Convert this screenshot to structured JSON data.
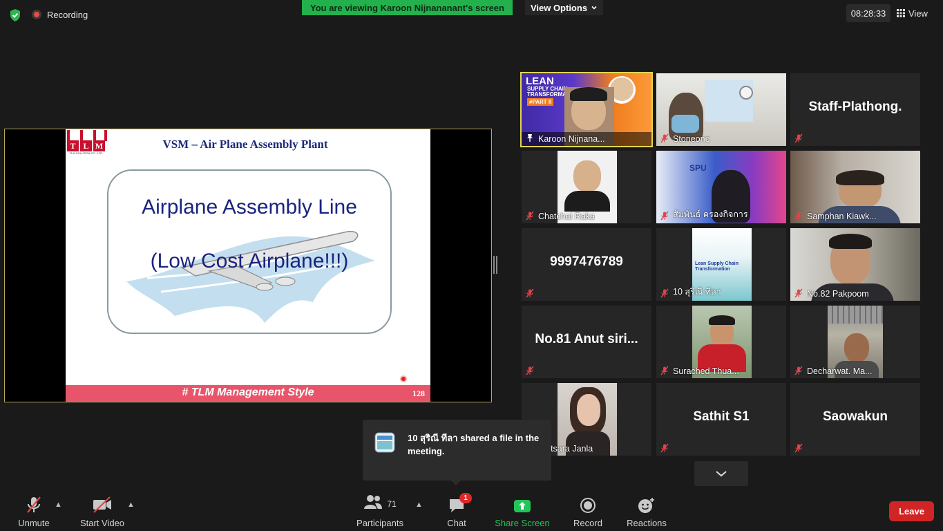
{
  "top": {
    "recording": "Recording",
    "viewing_banner": "You are viewing Karoon Nijnananant's screen",
    "view_options": "View Options",
    "time": "08:28:33",
    "view": "View"
  },
  "slide": {
    "title": "VSM – Air Plane Assembly Plant",
    "logo": "TLM",
    "logo_sub": "TLM SOLUTION CO., LTD.",
    "line1": "Airplane Assembly Line",
    "line2": "(Low Cost Airplane!!!)",
    "footer": "# TLM Management Style",
    "page": "128"
  },
  "participants": [
    {
      "name": "Karoon Nijnana...",
      "type": "video",
      "active": true
    },
    {
      "name": "Stoneone",
      "type": "video"
    },
    {
      "name": "Staff-Plathong.",
      "type": "text"
    },
    {
      "name": "Chatchai Raka",
      "type": "video"
    },
    {
      "name": "สัมพันธ์ ครองกิจการ",
      "type": "video"
    },
    {
      "name": "Samphan Kiawk...",
      "type": "video"
    },
    {
      "name": "9997476789",
      "type": "text"
    },
    {
      "name": "10 สุริณี ทีลา",
      "type": "video"
    },
    {
      "name": "No.82 Pakpoom",
      "type": "video"
    },
    {
      "name": "No.81  Anut siri...",
      "type": "text"
    },
    {
      "name": "Surached Thua...",
      "type": "video"
    },
    {
      "name": "Decharwat. Ma...",
      "type": "video"
    },
    {
      "name": "Phitsara Janla",
      "type": "video"
    },
    {
      "name": "Sathit S1",
      "type": "text"
    },
    {
      "name": "Saowakun",
      "type": "text"
    }
  ],
  "tile_texts": {
    "lean": "LEAN",
    "supply": "SUPPLY CHAIN",
    "transform": "TRANSFORMATI",
    "part": "#PART II",
    "spu": "SPU",
    "lsc": "Lean Supply Chain",
    "transformation": "Transformation"
  },
  "toast": {
    "message": "10 สุริณี ทีลา shared a file in the meeting."
  },
  "toolbar": {
    "unmute": "Unmute",
    "start_video": "Start Video",
    "participants": "Participants",
    "participant_count": "71",
    "chat": "Chat",
    "chat_badge": "1",
    "share_screen": "Share Screen",
    "record": "Record",
    "reactions": "Reactions",
    "leave": "Leave"
  },
  "colors": {
    "banner_green": "#23b14d",
    "leave_red": "#d12424",
    "active_speaker": "#e3d54e"
  }
}
